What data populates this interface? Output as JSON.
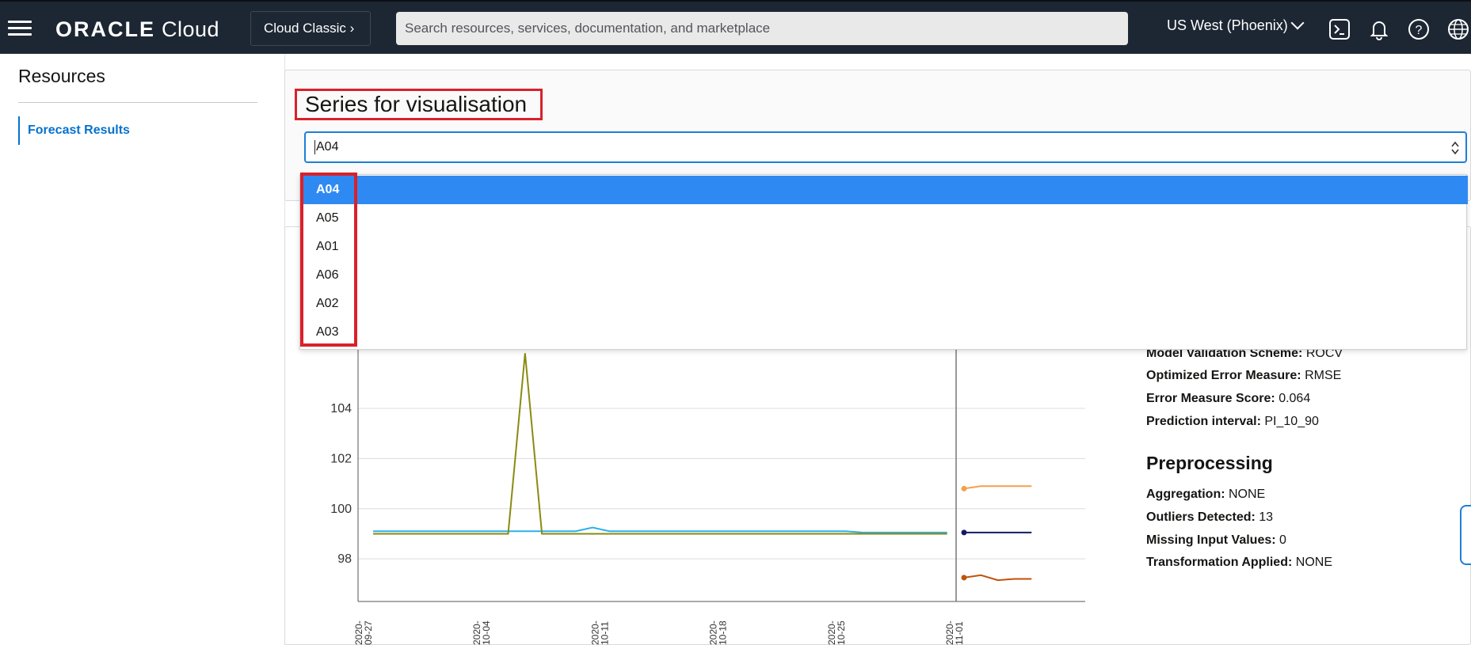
{
  "topbar": {
    "brand_bold": "ORACLE",
    "brand_light": "Cloud",
    "classic_label": "Cloud Classic",
    "search_placeholder": "Search resources, services, documentation, and marketplace",
    "region_label": "US West (Phoenix)",
    "icons": [
      "menu-icon",
      "cloud-shell-icon",
      "bell-icon",
      "help-icon",
      "globe-icon"
    ]
  },
  "sidebar": {
    "title": "Resources",
    "items": [
      {
        "label": "Forecast Results",
        "active": true
      }
    ]
  },
  "series": {
    "title": "Series for visualisation",
    "selected": "A04",
    "options": [
      "A04",
      "A05",
      "A01",
      "A06",
      "A02",
      "A03"
    ]
  },
  "info": {
    "partial_label": "Model Validation Scheme:",
    "partial_value": "ROCV",
    "rows": [
      {
        "label": "Optimized Error Measure:",
        "value": "RMSE"
      },
      {
        "label": "Error Measure Score:",
        "value": "0.064"
      },
      {
        "label": "Prediction interval:",
        "value": "PI_10_90"
      }
    ],
    "preprocessing_title": "Preprocessing",
    "preprocessing": [
      {
        "label": "Aggregation:",
        "value": "NONE"
      },
      {
        "label": "Outliers Detected:",
        "value": "13"
      },
      {
        "label": "Missing Input Values:",
        "value": "0"
      },
      {
        "label": "Transformation Applied:",
        "value": "NONE"
      }
    ]
  },
  "colors": {
    "accent": "#2e8af2",
    "highlight_box": "#d9212a",
    "topbar": "#1d2733"
  },
  "chart_data": {
    "type": "line",
    "yticks": [
      98,
      100,
      102,
      104
    ],
    "ylim": [
      96.3,
      106.4
    ],
    "xticks": [
      "2020-09-27",
      "2020-10-04",
      "2020-10-11",
      "2020-10-18",
      "2020-10-25",
      "2020-11-01"
    ],
    "x_start": "2020-09-27",
    "forecast_start": "2020-11-01",
    "series": [
      {
        "color": "#2bb0e8",
        "x": [
          "2020-09-27",
          "2020-09-28",
          "2020-09-29",
          "2020-09-30",
          "2020-10-01",
          "2020-10-02",
          "2020-10-03",
          "2020-10-04",
          "2020-10-05",
          "2020-10-06",
          "2020-10-07",
          "2020-10-08",
          "2020-10-09",
          "2020-10-10",
          "2020-10-11",
          "2020-10-12",
          "2020-10-13",
          "2020-10-14",
          "2020-10-15",
          "2020-10-16",
          "2020-10-17",
          "2020-10-18",
          "2020-10-19",
          "2020-10-20",
          "2020-10-21",
          "2020-10-22",
          "2020-10-23",
          "2020-10-24",
          "2020-10-25",
          "2020-10-26",
          "2020-10-27",
          "2020-10-28",
          "2020-10-29",
          "2020-10-30",
          "2020-10-31"
        ],
        "values": [
          99.1,
          99.1,
          99.1,
          99.1,
          99.1,
          99.1,
          99.1,
          99.1,
          99.1,
          99.1,
          99.1,
          99.1,
          99.1,
          99.25,
          99.1,
          99.1,
          99.1,
          99.1,
          99.1,
          99.1,
          99.1,
          99.1,
          99.1,
          99.1,
          99.1,
          99.1,
          99.1,
          99.1,
          99.1,
          99.05,
          99.05,
          99.05,
          99.05,
          99.05,
          99.05
        ]
      },
      {
        "color": "#8a8a12",
        "x": [
          "2020-09-27",
          "2020-10-01",
          "2020-10-05",
          "2020-10-06",
          "2020-10-07",
          "2020-10-11",
          "2020-10-18",
          "2020-10-25",
          "2020-10-31"
        ],
        "values": [
          99.0,
          99.0,
          99.0,
          106.2,
          99.0,
          99.0,
          99.0,
          99.0,
          99.0
        ]
      },
      {
        "color": "#f5a04a",
        "x": [
          "2020-11-01",
          "2020-11-02",
          "2020-11-03",
          "2020-11-04",
          "2020-11-05"
        ],
        "values": [
          100.8,
          100.9,
          100.9,
          100.9,
          100.9
        ]
      },
      {
        "color": "#141a66",
        "x": [
          "2020-11-01",
          "2020-11-02",
          "2020-11-03",
          "2020-11-04",
          "2020-11-05"
        ],
        "values": [
          99.05,
          99.05,
          99.05,
          99.05,
          99.05
        ]
      },
      {
        "color": "#c0520a",
        "x": [
          "2020-11-01",
          "2020-11-02",
          "2020-11-03",
          "2020-11-04",
          "2020-11-05"
        ],
        "values": [
          97.25,
          97.35,
          97.15,
          97.2,
          97.2
        ]
      }
    ]
  }
}
